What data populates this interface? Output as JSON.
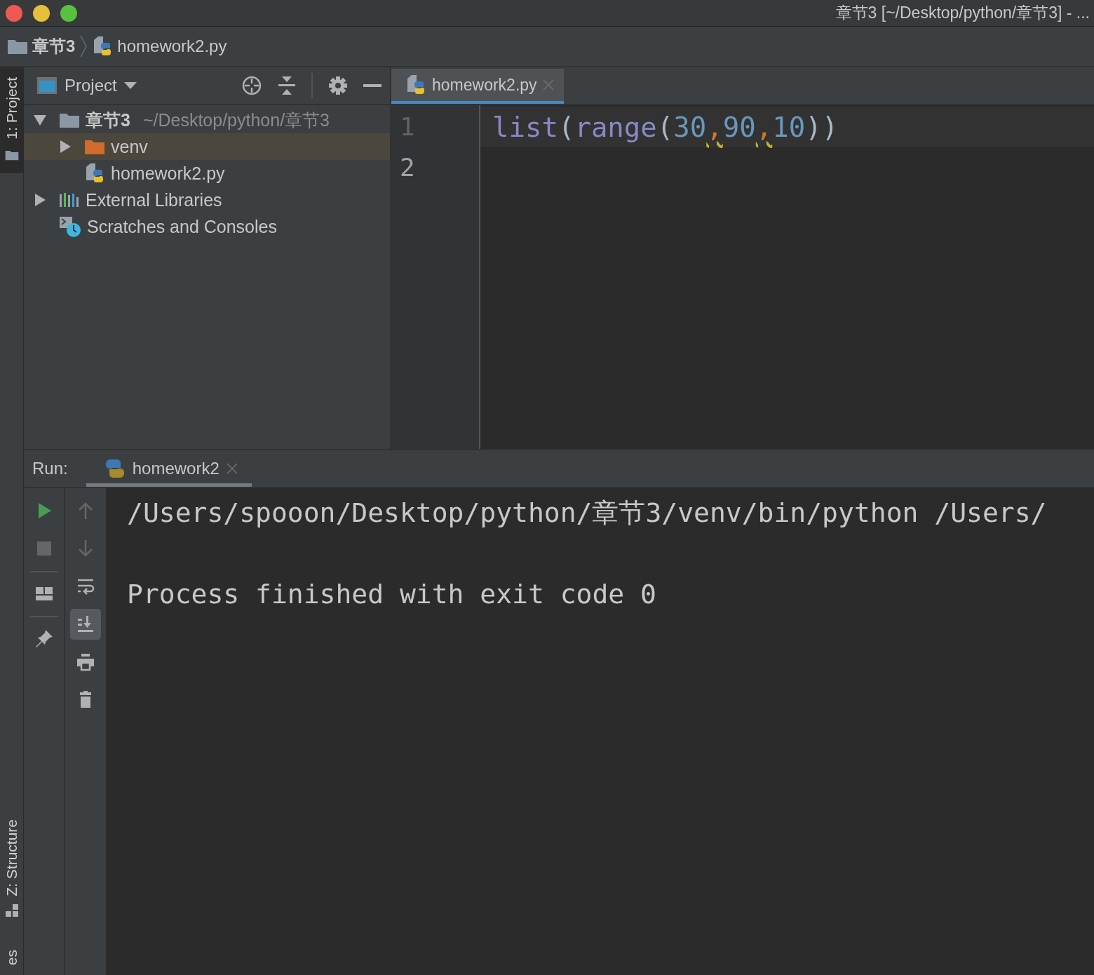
{
  "window": {
    "title": "章节3 [~/Desktop/python/章节3] - ..."
  },
  "breadcrumb": [
    {
      "label": "章节3",
      "kind": "folder"
    },
    {
      "label": "homework2.py",
      "kind": "python-file"
    }
  ],
  "side_stripe": {
    "top": [
      {
        "label": "1: Project",
        "kind": "folder",
        "selected": true
      }
    ],
    "bottom": [
      {
        "label": "Z: Structure",
        "kind": "structure",
        "selected": false
      },
      {
        "label": "es",
        "kind": "none",
        "selected": false
      }
    ]
  },
  "project_panel": {
    "title": "Project",
    "tree": [
      {
        "label": "章节3",
        "path": "~/Desktop/python/章节3",
        "kind": "folder",
        "expanded": true,
        "selected": false,
        "children": [
          {
            "label": "venv",
            "kind": "excluded-folder",
            "expanded": false,
            "selected": true
          },
          {
            "label": "homework2.py",
            "kind": "python-file",
            "selected": false
          }
        ]
      },
      {
        "label": "External Libraries",
        "kind": "libraries",
        "expanded": false,
        "selected": false
      },
      {
        "label": "Scratches and Consoles",
        "kind": "scratches",
        "selected": false
      }
    ]
  },
  "editor": {
    "tabs": [
      {
        "label": "homework2.py",
        "selected": true
      }
    ],
    "lines": [
      {
        "number": "1",
        "current": true,
        "tokens": [
          {
            "text": "list",
            "kind": "builtin"
          },
          {
            "text": "(",
            "kind": "punct"
          },
          {
            "text": "range",
            "kind": "builtin"
          },
          {
            "text": "(",
            "kind": "punct"
          },
          {
            "text": "30",
            "kind": "number"
          },
          {
            "text": ",",
            "kind": "comma",
            "warning": true
          },
          {
            "text": "90",
            "kind": "number"
          },
          {
            "text": ",",
            "kind": "comma",
            "warning": true
          },
          {
            "text": "10",
            "kind": "number"
          },
          {
            "text": "))",
            "kind": "punct"
          }
        ]
      },
      {
        "number": "2",
        "current": false
      }
    ]
  },
  "run_panel": {
    "label": "Run:",
    "tabs": [
      {
        "label": "homework2",
        "selected": true
      }
    ],
    "toolbar_left": [
      {
        "kind": "run",
        "disabled": false
      },
      {
        "kind": "stop",
        "disabled": true
      },
      {
        "kind": "separator"
      },
      {
        "kind": "layout",
        "disabled": false
      },
      {
        "kind": "separator"
      },
      {
        "kind": "pin",
        "disabled": false
      }
    ],
    "toolbar_right": [
      {
        "kind": "up",
        "disabled": true,
        "on": false
      },
      {
        "kind": "down",
        "disabled": true,
        "on": false
      },
      {
        "kind": "wrap",
        "disabled": false,
        "on": false
      },
      {
        "kind": "scroll-end",
        "disabled": false,
        "on": true
      },
      {
        "kind": "print",
        "disabled": false,
        "on": false
      },
      {
        "kind": "trash",
        "disabled": false,
        "on": false
      }
    ],
    "console": [
      "/Users/spooon/Desktop/python/章节3/venv/bin/python /Users/",
      "Process finished with exit code 0"
    ]
  }
}
